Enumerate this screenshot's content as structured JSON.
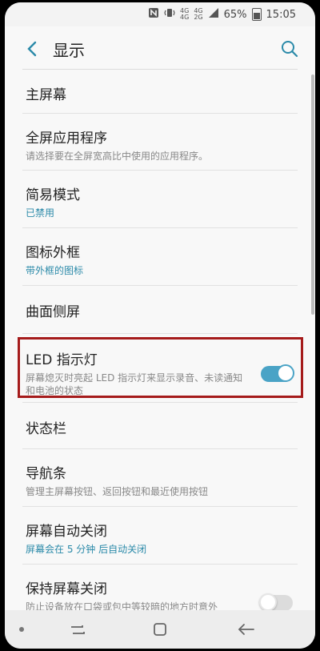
{
  "status_bar": {
    "icons": [
      "nfc-icon",
      "vibrate-icon",
      "signal-4g-icon",
      "signal-4g-2-icon"
    ],
    "battery": "65%",
    "time": "15:05",
    "network_top": "4G",
    "network_bottom": "4G",
    "network_top2": "4G",
    "network_bottom2": "2G"
  },
  "header": {
    "title": "显示"
  },
  "items": [
    {
      "label": "主屏幕",
      "sub": ""
    },
    {
      "label": "全屏应用程序",
      "sub": "请选择要在全屏宽高比中使用的应用程序。"
    },
    {
      "label": "简易模式",
      "sub": "已禁用"
    },
    {
      "label": "图标外框",
      "sub": "带外框的图标"
    },
    {
      "label": "曲面侧屏",
      "sub": ""
    },
    {
      "label": "LED 指示灯",
      "sub": "屏幕熄灭时亮起 LED 指示灯来显示录音、未读通知和电池的状态",
      "toggle": true
    },
    {
      "label": "状态栏",
      "sub": ""
    },
    {
      "label": "导航条",
      "sub": "管理主屏幕按钮、返回按钮和最近使用按钮"
    },
    {
      "label": "屏幕自动关闭",
      "sub": "屏幕会在 5 分钟 后自动关闭"
    },
    {
      "label": "保持屏幕关闭",
      "sub": "防止设备放在口袋或包中等较暗的地方时意外",
      "toggle": false
    }
  ],
  "colors": {
    "accent": "#4aa3c6",
    "highlight_border": "#a51b1b"
  }
}
